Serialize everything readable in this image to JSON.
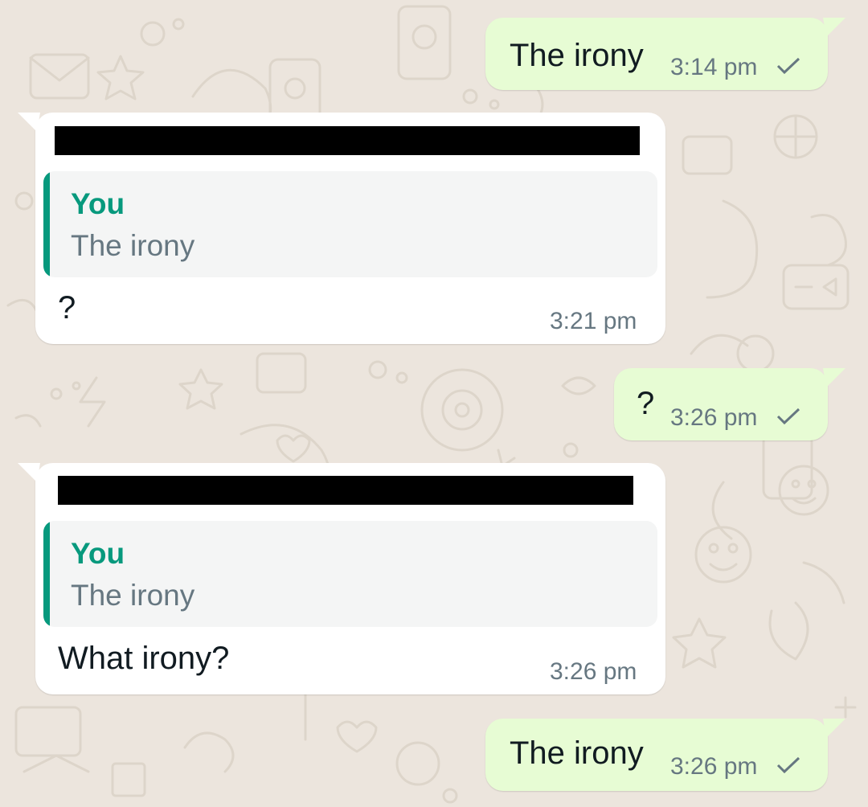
{
  "conversation": {
    "messages": [
      {
        "direction": "outgoing",
        "text": "The irony",
        "time": "3:14 pm",
        "status_icon": "single-check-icon"
      },
      {
        "direction": "incoming",
        "sender": "[redacted]",
        "reply_to": {
          "author": "You",
          "text": "The irony"
        },
        "text": "?",
        "time": "3:21 pm"
      },
      {
        "direction": "outgoing",
        "text": "?",
        "time": "3:26 pm",
        "status_icon": "single-check-icon"
      },
      {
        "direction": "incoming",
        "sender": "[redacted]",
        "reply_to": {
          "author": "You",
          "text": "The irony"
        },
        "text": "What irony?",
        "time": "3:26 pm"
      },
      {
        "direction": "outgoing",
        "text": "The irony",
        "time": "3:26 pm",
        "status_icon": "single-check-icon"
      }
    ]
  },
  "colors": {
    "background": "#ece5dd",
    "outgoing_bubble": "#e7fcd4",
    "incoming_bubble": "#ffffff",
    "reply_accent": "#07997d",
    "meta_text": "#667781",
    "message_text": "#111b21"
  }
}
